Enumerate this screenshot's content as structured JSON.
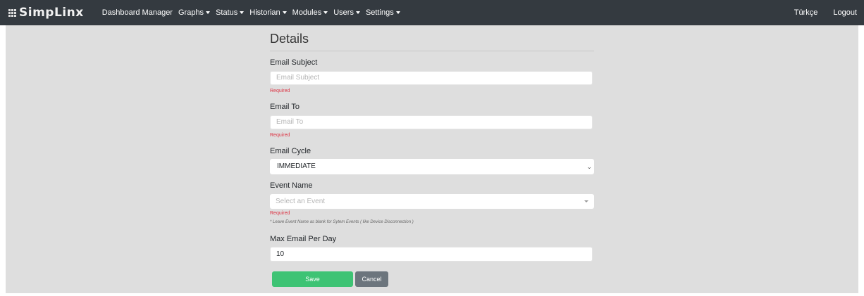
{
  "navbar": {
    "brand": "SimpLinx",
    "items": [
      {
        "label": "Dashboard Manager",
        "dropdown": false
      },
      {
        "label": "Graphs",
        "dropdown": true
      },
      {
        "label": "Status",
        "dropdown": true
      },
      {
        "label": "Historian",
        "dropdown": true
      },
      {
        "label": "Modules",
        "dropdown": true
      },
      {
        "label": "Users",
        "dropdown": true
      },
      {
        "label": "Settings",
        "dropdown": true
      }
    ],
    "language": "Türkçe",
    "logout": "Logout"
  },
  "form": {
    "title": "Details",
    "email_subject": {
      "label": "Email Subject",
      "placeholder": "Email Subject",
      "value": "",
      "error": "Required"
    },
    "email_to": {
      "label": "Email To",
      "placeholder": "Email To",
      "value": "",
      "error": "Required"
    },
    "email_cycle": {
      "label": "Email Cycle",
      "value": "IMMEDIATE"
    },
    "event_name": {
      "label": "Event Name",
      "placeholder": "Select an Event",
      "error": "Required",
      "note": "* Leave Event Name as blank for Sytem Events ( like Device Disconnection )"
    },
    "max_email": {
      "label": "Max Email Per Day",
      "value": "10"
    },
    "save_label": "Save",
    "cancel_label": "Cancel"
  },
  "icons": {
    "brand": "grid-icon",
    "dropdown": "caret-down-icon",
    "select": "chevron-down-icon"
  },
  "colors": {
    "navbar": "#343a40",
    "background": "#dedede",
    "save": "#3ec374",
    "cancel": "#6c757d",
    "error": "#dc3545"
  }
}
